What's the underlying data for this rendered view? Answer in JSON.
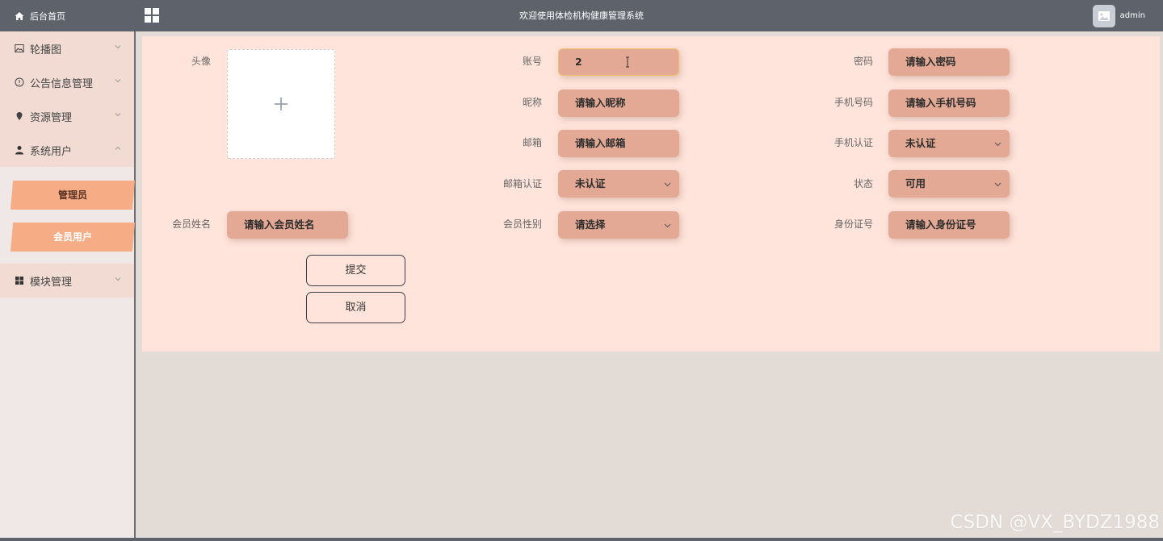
{
  "header": {
    "home_label": "后台首页",
    "system_title": "欢迎使用体检机构健康管理系统",
    "user_name": "admin"
  },
  "sidebar": {
    "items": [
      {
        "label": "轮播图",
        "icon": "image-icon"
      },
      {
        "label": "公告信息管理",
        "icon": "info-circle-icon"
      },
      {
        "label": "资源管理",
        "icon": "pin-icon"
      },
      {
        "label": "系统用户",
        "icon": "user-icon"
      },
      {
        "label": "模块管理",
        "icon": "grid-icon"
      }
    ],
    "submenu": [
      {
        "label": "管理员"
      },
      {
        "label": "会员用户"
      }
    ]
  },
  "form": {
    "avatar_label": "头像",
    "account": {
      "label": "账号",
      "value": "2"
    },
    "password": {
      "label": "密码",
      "placeholder": "请输入密码"
    },
    "nickname": {
      "label": "昵称",
      "placeholder": "请输入昵称"
    },
    "phone": {
      "label": "手机号码",
      "placeholder": "请输入手机号码"
    },
    "email": {
      "label": "邮箱",
      "placeholder": "请输入邮箱"
    },
    "phone_verify": {
      "label": "手机认证",
      "value": "未认证"
    },
    "email_verify": {
      "label": "邮箱认证",
      "value": "未认证"
    },
    "status": {
      "label": "状态",
      "value": "可用"
    },
    "member_name": {
      "label": "会员姓名",
      "placeholder": "请输入会员姓名"
    },
    "gender": {
      "label": "会员性别",
      "value": "请选择"
    },
    "id_card": {
      "label": "身份证号",
      "placeholder": "请输入身份证号"
    },
    "submit_label": "提交",
    "cancel_label": "取消"
  },
  "watermark": "CSDN @VX_BYDZ1988",
  "colors": {
    "header_bg": "#5e636b",
    "panel_bg": "#ffe4db",
    "field_bg": "#e3a994",
    "submenu_bg": "#f6ad86",
    "menu_bg": "#f1dbd2"
  }
}
